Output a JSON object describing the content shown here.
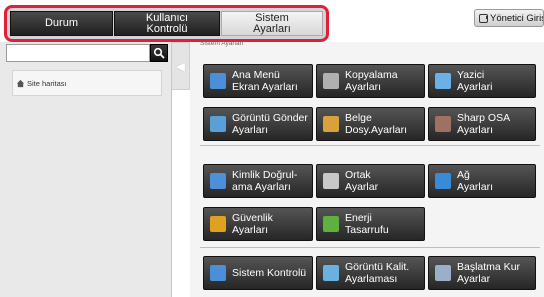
{
  "tabs": [
    {
      "label": "Durum",
      "style": "dark"
    },
    {
      "label": "Kullanıcı\nKontrolü",
      "style": "dark"
    },
    {
      "label": "Sistem\nAyarları",
      "style": "light"
    }
  ],
  "admin_login": {
    "label": "Yönetici Giriş"
  },
  "search": {
    "value": "",
    "placeholder": ""
  },
  "sidebar": {
    "sitemap_label": "Site haritası"
  },
  "breadcrumb": "Sistem Ayarları",
  "buttons": [
    {
      "id": "home-menu-screen-settings",
      "label": "Ana Menü\nEkran Ayarları",
      "icon": "home-icon"
    },
    {
      "id": "copy-settings",
      "label": "Kopyalama\nAyarları",
      "icon": "copy-icon"
    },
    {
      "id": "printer-settings",
      "label": "Yazici\nAyarlari",
      "icon": "printer-icon"
    },
    {
      "id": "image-send-settings",
      "label": "Görüntü Gönder\nAyarları",
      "icon": "image-send-icon"
    },
    {
      "id": "document-filing-settings",
      "label": "Belge\nDosy.Ayarları",
      "icon": "folder-icon"
    },
    {
      "id": "sharp-osa-settings",
      "label": "Sharp OSA\nAyarları",
      "icon": "osa-icon"
    },
    {
      "id": "authentication-settings",
      "label": "Kimlik Doğrul-\nama Ayarları",
      "icon": "users-icon"
    },
    {
      "id": "common-settings",
      "label": "Ortak\nAyarlar",
      "icon": "tools-icon"
    },
    {
      "id": "network-settings",
      "label": "Ağ\nAyarları",
      "icon": "globe-icon"
    },
    {
      "id": "security-settings",
      "label": "Güvenlik\nAyarları",
      "icon": "lock-icon"
    },
    {
      "id": "energy-save",
      "label": "Enerji\nTasarrufu",
      "icon": "leaf-icon"
    },
    {
      "id": "system-control",
      "label": "Sistem Kontrolü",
      "icon": "monitor-icon"
    },
    {
      "id": "image-quality-adjustment",
      "label": "Görüntü Kalit.\nAyarlaması",
      "icon": "quality-icon"
    },
    {
      "id": "startup-settings",
      "label": "Başlatma Kur\nAyarlar",
      "icon": "startup-icon"
    }
  ]
}
